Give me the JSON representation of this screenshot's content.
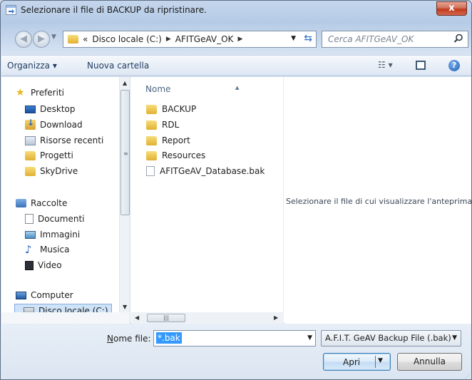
{
  "window": {
    "title": "Selezionare il file di BACKUP da ripristinare.",
    "close_label": "x"
  },
  "address": {
    "overflow": "«",
    "crumbs": [
      "Disco locale (C:)",
      "AFITGeAV_OK"
    ],
    "search_placeholder": "Cerca AFITGeAV_OK"
  },
  "toolbar": {
    "organize_label": "Organizza ▾",
    "new_folder_label": "Nuova cartella",
    "view_label": "☷ ▾",
    "help_label": "?"
  },
  "nav": {
    "favorites_header": "Preferiti",
    "favorites": [
      "Desktop",
      "Download",
      "Risorse recenti",
      "Progetti",
      "SkyDrive"
    ],
    "libraries_header": "Raccolte",
    "libraries": [
      "Documenti",
      "Immagini",
      "Musica",
      "Video"
    ],
    "computer_header": "Computer",
    "selected_drive": "Disco locale (C:)"
  },
  "files": {
    "column_name": "Nome",
    "items": [
      {
        "name": "BACKUP",
        "type": "folder"
      },
      {
        "name": "RDL",
        "type": "folder"
      },
      {
        "name": "Report",
        "type": "folder"
      },
      {
        "name": "Resources",
        "type": "folder"
      },
      {
        "name": "AFITGeAV_Database.bak",
        "type": "file"
      }
    ]
  },
  "preview": {
    "message": "Selezionare il file di cui visualizzare l'anteprima."
  },
  "footer": {
    "filename_label_hotkey": "N",
    "filename_label_rest": "ome file:",
    "filename_value": "*.bak",
    "filetype_value": "A.F.I.T. GeAV Backup File (.bak)",
    "open_label": "Apri",
    "cancel_label": "Annulla"
  },
  "colors": {
    "selection": "#3399ff",
    "close": "#c0391b",
    "accent": "#2b6bc2"
  }
}
